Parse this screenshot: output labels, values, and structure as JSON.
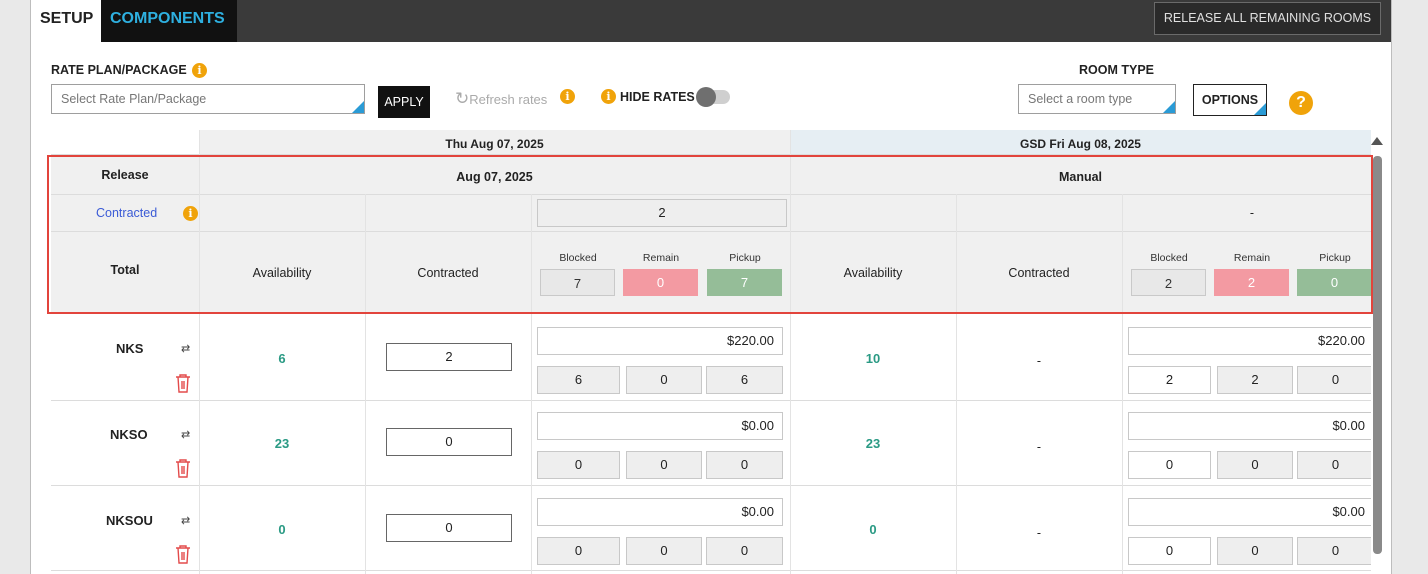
{
  "tabs": [
    {
      "label": "SETUP"
    },
    {
      "label": "COMPONENTS"
    }
  ],
  "toolbar": {
    "release_all_label": "RELEASE ALL REMAINING ROOMS"
  },
  "rate_plan": {
    "label": "RATE PLAN/PACKAGE",
    "placeholder": "Select Rate Plan/Package",
    "apply_label": "APPLY",
    "refresh_label": "Refresh rates",
    "hide_rates_label": "HIDE RATES"
  },
  "room_type": {
    "label": "ROOM TYPE",
    "placeholder": "Select a room type",
    "options_label": "OPTIONS"
  },
  "columns": {
    "day1": {
      "header": "Thu  Aug 07, 2025",
      "release": "Aug 07, 2025",
      "contracted_value": "2",
      "availability_label": "Availability",
      "contracted_label": "Contracted",
      "blocked_label": "Blocked",
      "remain_label": "Remain",
      "pickup_label": "Pickup",
      "blocked": "7",
      "remain": "0",
      "pickup": "7"
    },
    "day2": {
      "header": "GSD  Fri  Aug 08, 2025",
      "release": "Manual",
      "contracted_value": "-",
      "availability_label": "Availability",
      "contracted_label": "Contracted",
      "blocked_label": "Blocked",
      "remain_label": "Remain",
      "pickup_label": "Pickup",
      "blocked": "2",
      "remain": "2",
      "pickup": "0"
    }
  },
  "row_labels": {
    "release": "Release",
    "contracted": "Contracted",
    "total": "Total"
  },
  "rooms": [
    {
      "name": "NKS",
      "day1": {
        "availability": "6",
        "contracted": "2",
        "rate": "$220.00",
        "blocked": "6",
        "remain": "0",
        "pickup": "6"
      },
      "day2": {
        "availability": "10",
        "contracted": "-",
        "rate": "$220.00",
        "blocked": "2",
        "remain": "2",
        "pickup": "0"
      }
    },
    {
      "name": "NKSO",
      "day1": {
        "availability": "23",
        "contracted": "0",
        "rate": "$0.00",
        "blocked": "0",
        "remain": "0",
        "pickup": "0"
      },
      "day2": {
        "availability": "23",
        "contracted": "-",
        "rate": "$0.00",
        "blocked": "0",
        "remain": "0",
        "pickup": "0"
      }
    },
    {
      "name": "NKSOU",
      "day1": {
        "availability": "0",
        "contracted": "0",
        "rate": "$0.00",
        "blocked": "0",
        "remain": "0",
        "pickup": "0"
      },
      "day2": {
        "availability": "0",
        "contracted": "-",
        "rate": "$0.00",
        "blocked": "0",
        "remain": "0",
        "pickup": "0"
      }
    }
  ],
  "icons": {
    "info": "info-icon",
    "help": "question-icon",
    "swap": "swap-arrows-icon",
    "delete": "trash-icon",
    "refresh": "refresh-icon"
  },
  "colors": {
    "accent": "#2eb0e0",
    "info": "#f0a30a",
    "remain": "#f39aa2",
    "pickup": "#95bd98",
    "availability": "#2a9a84",
    "highlight": "#e2443c"
  }
}
